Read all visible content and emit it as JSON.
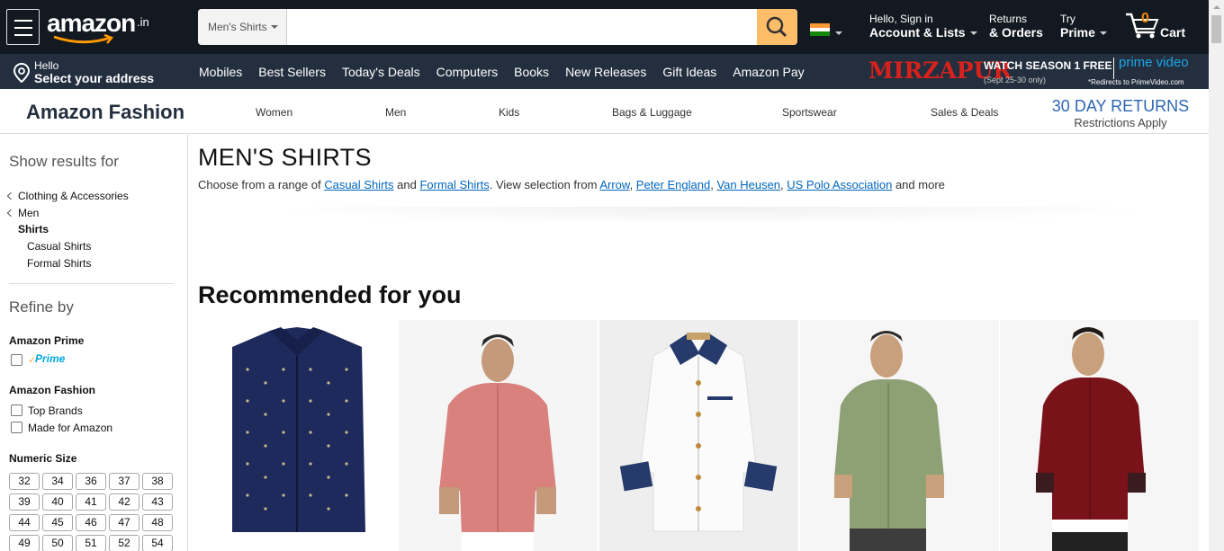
{
  "header": {
    "logo": "amazon",
    "logo_tld": ".in",
    "search": {
      "department": "Men's Shirts",
      "value": "",
      "placeholder": ""
    },
    "account_line1": "Hello, Sign in",
    "account_line2": "Account & Lists",
    "orders_line1": "Returns",
    "orders_line2": "& Orders",
    "prime_line1": "Try",
    "prime_line2": "Prime",
    "cart_count": "0",
    "cart_label": "Cart"
  },
  "subnav": {
    "address_line1": "Hello",
    "address_line2": "Select your address",
    "links": [
      "Mobiles",
      "Best Sellers",
      "Today's Deals",
      "Computers",
      "Books",
      "New Releases",
      "Gift Ideas",
      "Amazon Pay"
    ],
    "promo": {
      "show": "MIRZAPUR",
      "headline": "WATCH SEASON 1 FREE",
      "dates": "(Sept 25-30 only)",
      "brand": "prime video",
      "note": "*Redirects to PrimeVideo.com"
    }
  },
  "fashion": {
    "title": "Amazon Fashion",
    "nav": [
      "Women",
      "Men",
      "Kids",
      "Bags & Luggage",
      "Sportswear",
      "Sales & Deals"
    ],
    "returns_title": "30 DAY RETURNS",
    "returns_sub": "Restrictions Apply"
  },
  "sidebar": {
    "show_results": "Show results for",
    "categories": {
      "clothing": "Clothing & Accessories",
      "men": "Men",
      "shirts": "Shirts",
      "casual": "Casual Shirts",
      "formal": "Formal Shirts"
    },
    "refine_by": "Refine by",
    "amazon_prime_heading": "Amazon Prime",
    "prime_badge": "Prime",
    "amazon_fashion_heading": "Amazon Fashion",
    "top_brands": "Top Brands",
    "made_for_amazon": "Made for Amazon",
    "numeric_size_heading": "Numeric Size",
    "sizes": [
      "32",
      "34",
      "36",
      "37",
      "38",
      "39",
      "40",
      "41",
      "42",
      "43",
      "44",
      "45",
      "46",
      "47",
      "48",
      "49",
      "50",
      "51",
      "52",
      "54"
    ]
  },
  "main": {
    "title": "MEN'S SHIRTS",
    "desc_1": "Choose from a range of ",
    "desc_casual": "Casual Shirts",
    "desc_2": " and ",
    "desc_formal": "Formal Shirts",
    "desc_3": ". View selection from ",
    "brand_arrow": "Arrow",
    "brand_pe": "Peter England",
    "brand_vh": "Van Heusen",
    "brand_uspa": "US Polo Association",
    "desc_4": " and more",
    "recommended": "Recommended for you"
  },
  "products": [
    {
      "name": "navy-printed-shirt",
      "color": "#1f2a5c"
    },
    {
      "name": "pink-casual-shirt",
      "color": "#d9817d"
    },
    {
      "name": "white-contrast-shirt",
      "color": "#f7f7f7"
    },
    {
      "name": "olive-green-shirt",
      "color": "#8da174"
    },
    {
      "name": "maroon-shirt",
      "color": "#7a1219"
    }
  ],
  "colors": {
    "nav_dark": "#131921",
    "nav_secondary": "#232f3e",
    "search_button": "#febd69",
    "link_blue": "#0066c0",
    "cart_orange": "#f08804"
  }
}
